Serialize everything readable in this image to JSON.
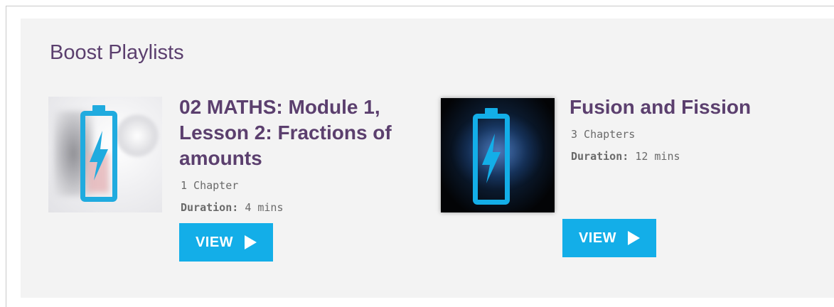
{
  "section": {
    "title": "Boost Playlists"
  },
  "playlists": [
    {
      "title_lines": [
        "02 MATHS: Module 1,",
        "Lesson 2: Fractions of",
        "amounts"
      ],
      "chapters": "1 Chapter",
      "duration_label": "Duration:",
      "duration_value": "4 mins",
      "button_label": "VIEW",
      "icon": "battery-bolt-icon"
    },
    {
      "title_lines": [
        "Fusion and Fission"
      ],
      "chapters": "3 Chapters",
      "duration_label": "Duration:",
      "duration_value": "12 mins",
      "button_label": "VIEW",
      "icon": "battery-bolt-icon"
    }
  ],
  "colors": {
    "accent": "#13aee8",
    "title": "#5b3f6e",
    "panel": "#f3f3f3",
    "meta_text": "#6a6a6a"
  }
}
